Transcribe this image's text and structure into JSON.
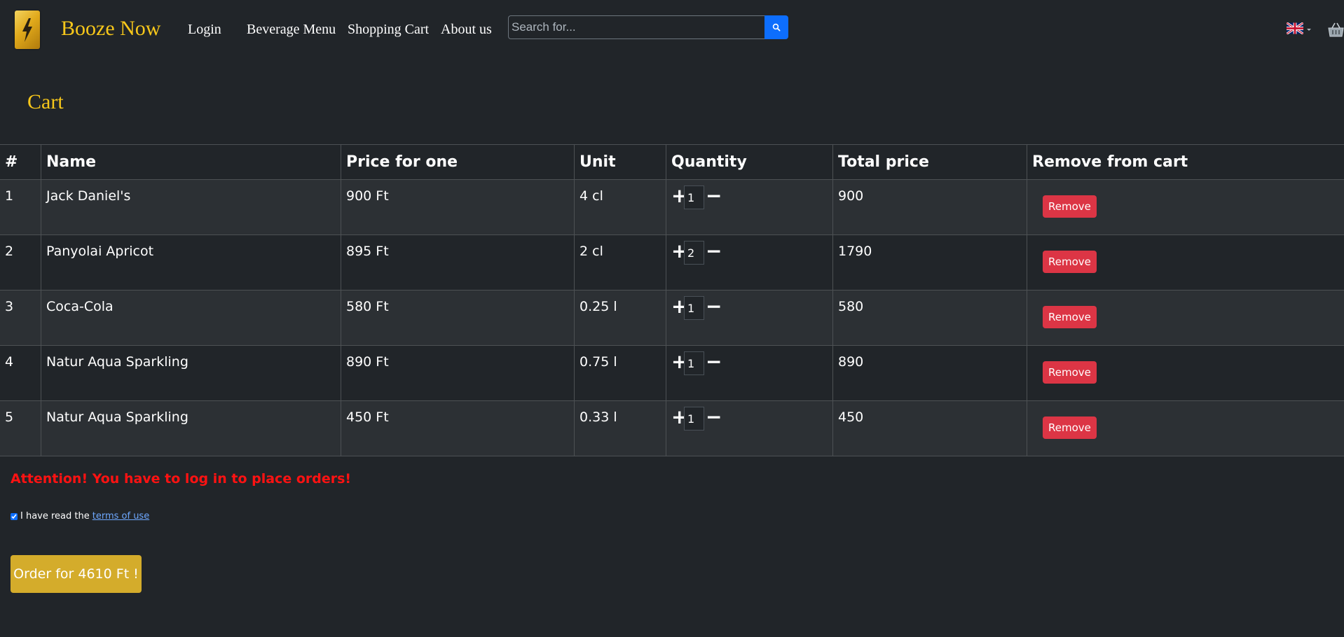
{
  "nav": {
    "brand": "Booze Now",
    "login": "Login",
    "beverage_menu": "Beverage Menu",
    "shopping_cart": "Shopping Cart",
    "about_us": "About us",
    "search_placeholder": "Search for...",
    "language": "EN"
  },
  "page": {
    "title": "Cart"
  },
  "cart": {
    "headers": [
      "#",
      "Name",
      "Price for one",
      "Unit",
      "Quantity",
      "Total price",
      "Remove from cart"
    ],
    "rows": [
      {
        "index": "1",
        "name": "Jack Daniel's",
        "price": "900 Ft",
        "unit": "4 cl",
        "quantity": "1",
        "total": "900",
        "remove": "Remove"
      },
      {
        "index": "2",
        "name": "Panyolai Apricot",
        "price": "895 Ft",
        "unit": "2 cl",
        "quantity": "2",
        "total": "1790",
        "remove": "Remove"
      },
      {
        "index": "3",
        "name": "Coca-Cola",
        "price": "580 Ft",
        "unit": "0.25 l",
        "quantity": "1",
        "total": "580",
        "remove": "Remove"
      },
      {
        "index": "4",
        "name": "Natur Aqua Sparkling",
        "price": "890 Ft",
        "unit": "0.75 l",
        "quantity": "1",
        "total": "890",
        "remove": "Remove"
      },
      {
        "index": "5",
        "name": "Natur Aqua Sparkling",
        "price": "450 Ft",
        "unit": "0.33 l",
        "quantity": "1",
        "total": "450",
        "remove": "Remove"
      }
    ],
    "plus_symbol": "+",
    "minus_symbol": "−"
  },
  "notice": {
    "attention": "Attention! You have to log in to place orders!"
  },
  "terms": {
    "checked": true,
    "prefix": "I have read the",
    "link": "terms of use"
  },
  "order": {
    "label": "Order for 4610 Ft !"
  },
  "colors": {
    "background": "#212529",
    "brand": "#f7c71a",
    "remove": "#dc3545",
    "order": "#d4ac2b",
    "attention": "#ff1212",
    "search_button": "#0d6efd"
  }
}
